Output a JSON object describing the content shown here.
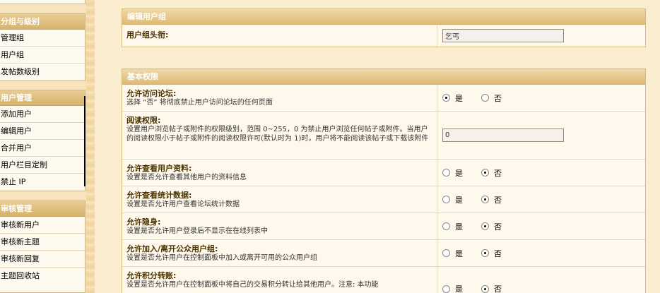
{
  "sidebar": {
    "groups": [
      {
        "title": "分组与级别",
        "items": [
          "管理组",
          "用户组",
          "发帖数级别"
        ]
      },
      {
        "title": "用户管理",
        "items": [
          "添加用户",
          "编辑用户",
          "合并用户",
          "用户栏目定制",
          "禁止 IP"
        ]
      },
      {
        "title": "审核管理",
        "items": [
          "审核新用户",
          "审核新主题",
          "审核新回复",
          "主题回收站"
        ]
      }
    ]
  },
  "edit_panel": {
    "title": "编辑用户组",
    "rows": [
      {
        "label": "用户组头衔:",
        "value": "乞丐"
      }
    ]
  },
  "perm_panel": {
    "title": "基本权限",
    "rows": [
      {
        "label": "允许访问论坛:",
        "desc": "选择 “否” 将彻底禁止用户访问论坛的任何页面",
        "type": "radio",
        "selected": "yes"
      },
      {
        "label": "阅读权限:",
        "desc": "设置用户浏览帖子或附件的权限级别，范围 0~255，0 为禁止用户浏览任何帖子或附件。当用户的阅读权限小于帖子或附件的阅读权限许可(默认时为 1)时，用户将不能阅读该帖子或下载该附件",
        "type": "text",
        "value": "0"
      },
      {
        "label": "允许查看用户资料:",
        "desc": "设置是否允许查看其他用户的资料信息",
        "type": "radio",
        "selected": "no"
      },
      {
        "label": "允许查看统计数据:",
        "desc": "设置是否允许用户查看论坛统计数据",
        "type": "radio",
        "selected": "no"
      },
      {
        "label": "允许隐身:",
        "desc": "设置是否允许用户登录后不显示在在线列表中",
        "type": "radio",
        "selected": "no"
      },
      {
        "label": "允许加入/离开公众用户组:",
        "desc": "设置是否允许用户在控制面板中加入或离开可用的公众用户组",
        "type": "radio",
        "selected": "no"
      },
      {
        "label": "允许积分转账:",
        "desc": "设置是否允许用户在控制面板中将自己的交易积分转让给其他用户。注意: 本功能",
        "type": "radio",
        "selected": "no"
      }
    ],
    "yes_label": "是",
    "no_label": "否"
  }
}
